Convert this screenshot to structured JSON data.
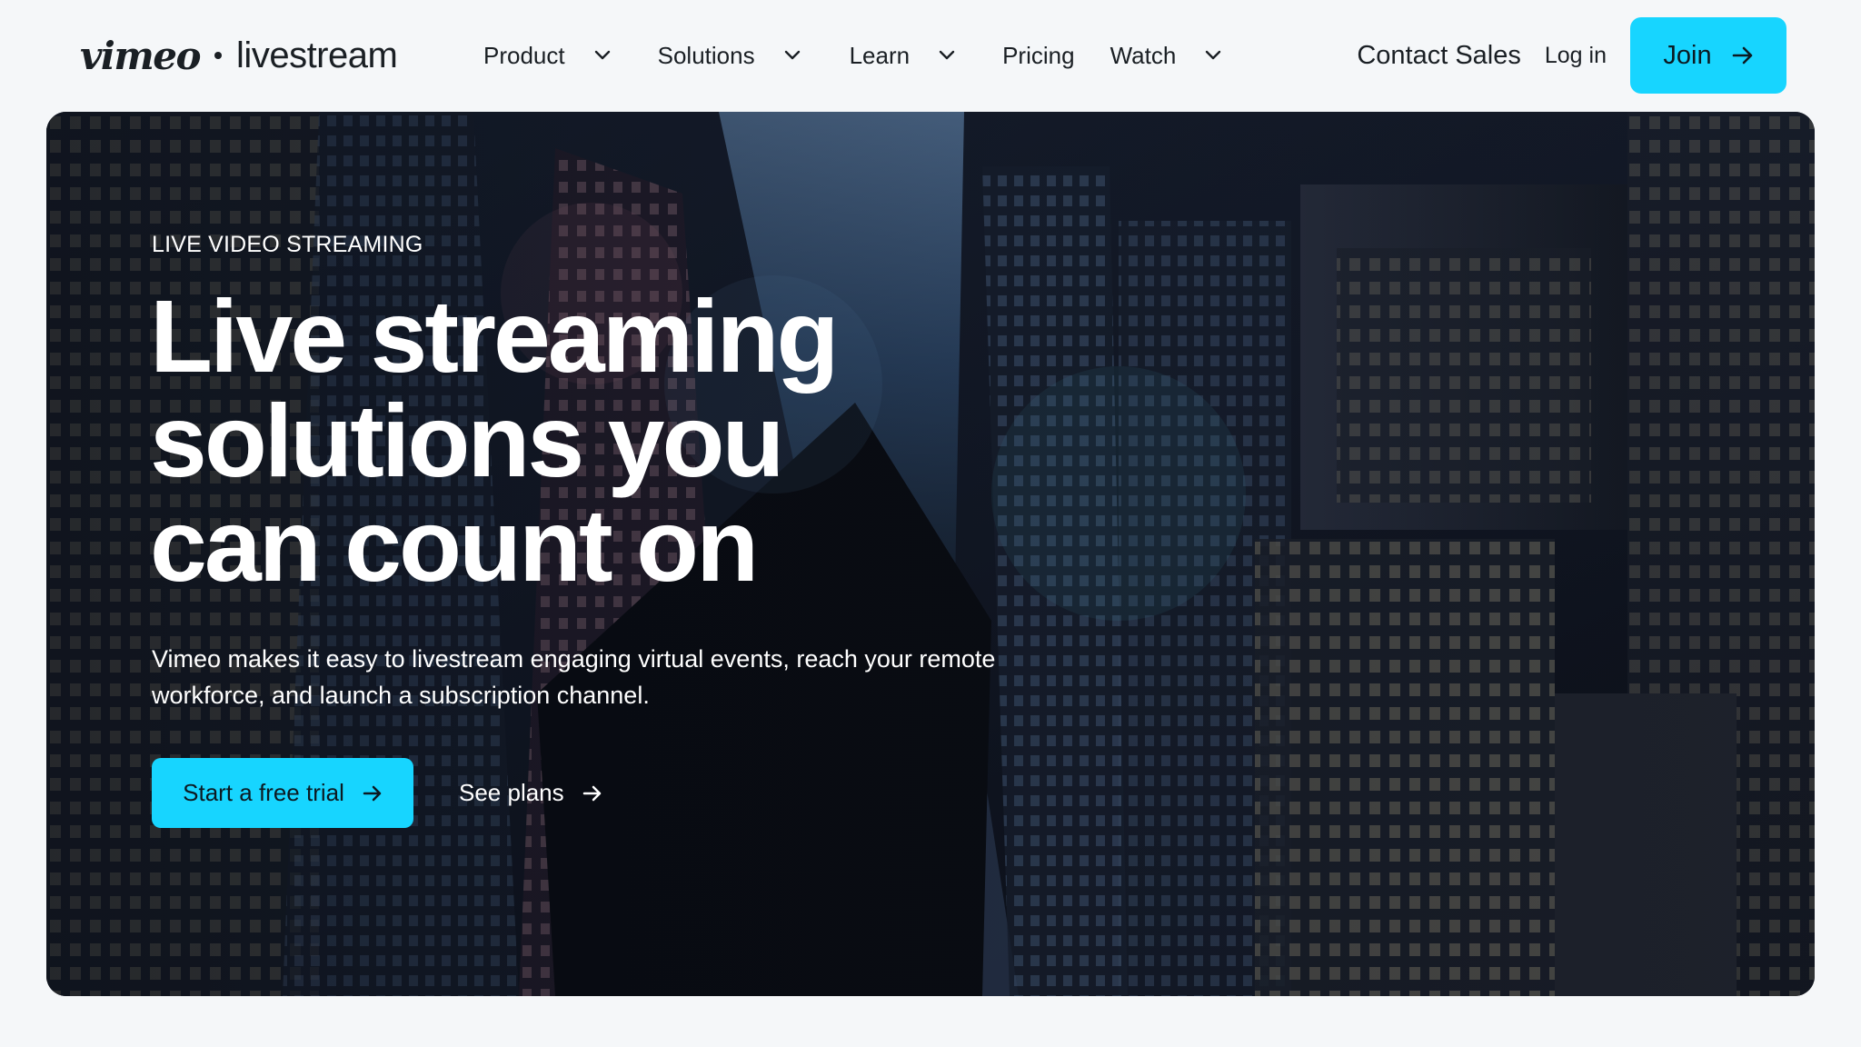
{
  "header": {
    "logo": {
      "brand": "vimeo",
      "product": "livestream"
    },
    "nav": [
      {
        "label": "Product",
        "has_dropdown": true
      },
      {
        "label": "Solutions",
        "has_dropdown": true
      },
      {
        "label": "Learn",
        "has_dropdown": true
      },
      {
        "label": "Pricing",
        "has_dropdown": false
      },
      {
        "label": "Watch",
        "has_dropdown": true
      }
    ],
    "contact_sales": "Contact Sales",
    "login": "Log in",
    "join": "Join"
  },
  "hero": {
    "eyebrow": "LIVE VIDEO STREAMING",
    "headline_lines": [
      "Live streaming",
      "solutions you",
      "can count on"
    ],
    "subcopy_lines": [
      "Vimeo makes it easy to livestream engaging virtual events, reach your remote",
      "workforce, and launch a subscription channel."
    ],
    "primary_cta": "Start a free trial",
    "secondary_cta": "See plans"
  },
  "colors": {
    "accent": "#17d5ff",
    "text_dark": "#1a1f24",
    "page_bg": "#f5f7f9"
  },
  "icons": {
    "dropdown": "chevron-down-icon",
    "cta": "arrow-right-icon"
  }
}
